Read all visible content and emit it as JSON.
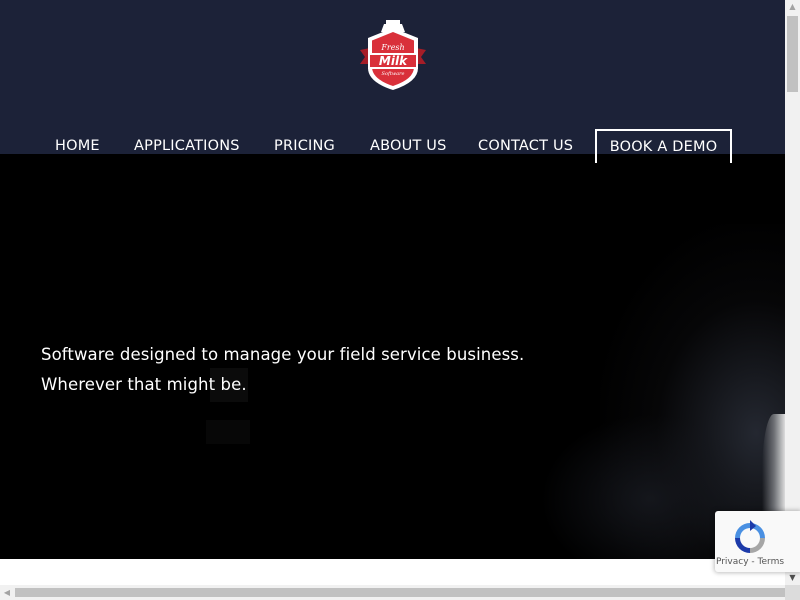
{
  "logo": {
    "line1": "Fresh",
    "line2": "Milk",
    "line3": "Software",
    "colors": {
      "red": "#d9303a",
      "dark_red": "#a51d27",
      "white": "#ffffff"
    }
  },
  "nav": {
    "items": [
      {
        "label": "HOME"
      },
      {
        "label": "APPLICATIONS"
      },
      {
        "label": "PRICING"
      },
      {
        "label": "ABOUT US"
      },
      {
        "label": "CONTACT US"
      }
    ],
    "demo_label": "BOOK A DEMO"
  },
  "hero": {
    "line1": "Software designed to manage your field service business.",
    "line2": "Wherever that might be."
  },
  "recaptcha": {
    "icon": "recaptcha-icon",
    "privacy": "Privacy",
    "separator": "-",
    "terms": "Terms"
  },
  "colors": {
    "header_bg": "#1c2238",
    "hero_bg": "#000000",
    "text": "#ffffff"
  }
}
